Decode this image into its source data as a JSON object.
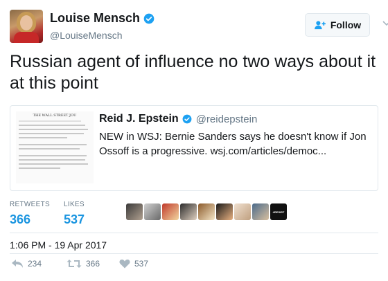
{
  "author": {
    "name": "Louise Mensch",
    "handle": "@LouiseMensch",
    "verified": true
  },
  "follow_label": "Follow",
  "tweet_text": "Russian agent of influence no two ways about it at this point",
  "quoted": {
    "name": "Reid J. Epstein",
    "handle": "@reidepstein",
    "verified": true,
    "text": "NEW in WSJ: Bernie Sanders says he doesn't know if Jon Ossoff is a progressive. wsj.com/articles/democ...",
    "thumb_masthead": "THE WALL STREET JOU"
  },
  "stats": {
    "retweets_label": "RETWEETS",
    "retweets": "366",
    "likes_label": "LIKES",
    "likes": "537",
    "liker_last_label": "#RESIST"
  },
  "timestamp": "1:06 PM - 19 Apr 2017",
  "actions": {
    "replies": "234",
    "retweets": "366",
    "likes": "537"
  },
  "colors": {
    "accent": "#1b95e0",
    "muted": "#657786",
    "border": "#e1e8ed"
  },
  "icons": [
    "verified-icon",
    "follow-person-icon",
    "chevron-down-icon",
    "reply-icon",
    "retweet-icon",
    "like-icon"
  ]
}
